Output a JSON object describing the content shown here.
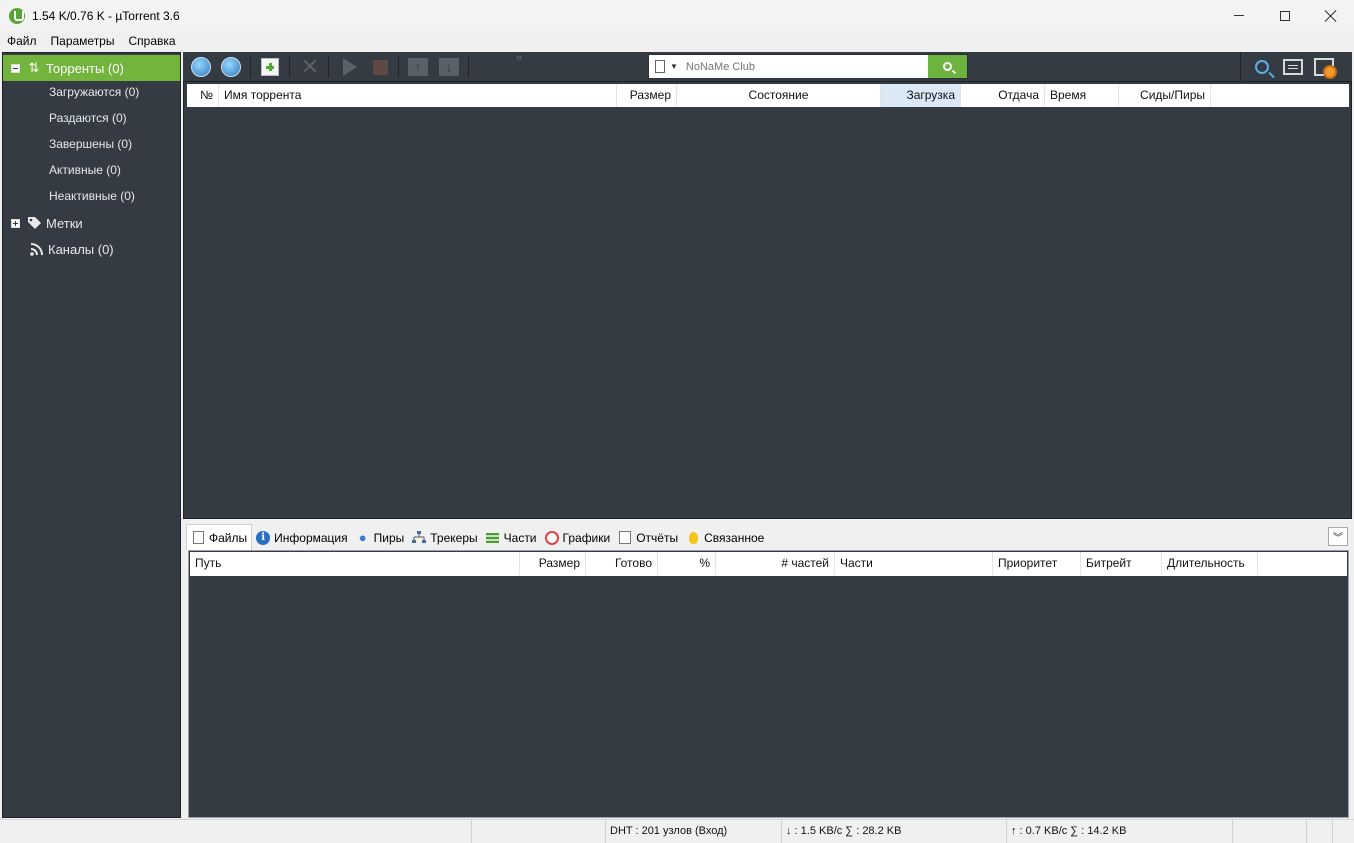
{
  "window": {
    "title": "1.54 K/0.76 K - µTorrent 3.6"
  },
  "menu": [
    "Файл",
    "Параметры",
    "Справка"
  ],
  "sidebar": {
    "torrents": "Торренты (0)",
    "items": [
      "Загружаются (0)",
      "Раздаются (0)",
      "Завершены (0)",
      "Активные (0)",
      "Неактивные (0)"
    ],
    "labels": "Метки",
    "feeds": "Каналы (0)"
  },
  "toolbar": {
    "more": "»",
    "search": {
      "placeholder": "NoNaMe Club"
    }
  },
  "torrent_list": {
    "columns": [
      "№",
      "Имя торрента",
      "Размер",
      "Состояние",
      "Загрузка",
      "Отдача",
      "Время",
      "Сиды/Пиры"
    ],
    "sorted_column": "Загрузка"
  },
  "details": {
    "tabs": [
      "Файлы",
      "Информация",
      "Пиры",
      "Трекеры",
      "Части",
      "Графики",
      "Отчёты",
      "Связанное"
    ],
    "active_tab": "Файлы",
    "file_columns": [
      "Путь",
      "Размер",
      "Готово",
      "%",
      "# частей",
      "Части",
      "Приоритет",
      "Битрейт",
      "Длительность"
    ]
  },
  "status": {
    "dht": "DHT : 201 узлов (Вход)",
    "down": "↓ : 1.5 KB/с  ∑ : 28.2 KB",
    "up": "↑ : 0.7 KB/с  ∑ : 14.2 KB"
  },
  "colors": {
    "sidebar_bg": "#353b42",
    "selected_green": "#73b43c",
    "search_green": "#6db33f",
    "sorted_header": "#dbe9f7"
  }
}
